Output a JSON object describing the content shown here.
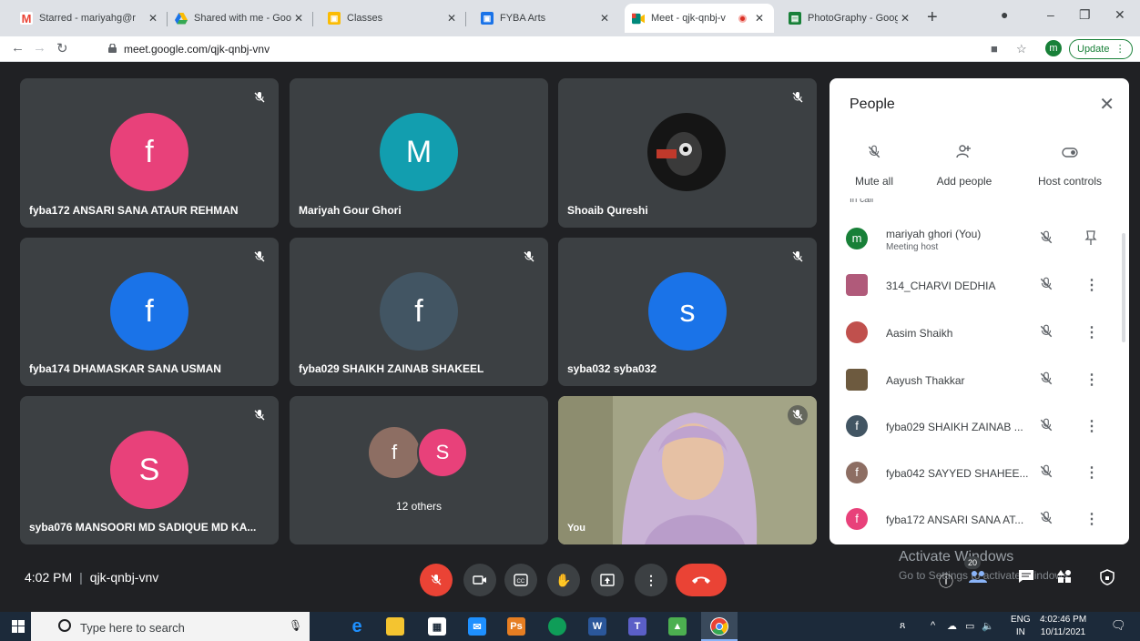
{
  "browser": {
    "tabs": [
      {
        "title": "Starred - mariyahg@r",
        "favicon": "gmail-icon",
        "color": "#ea4335"
      },
      {
        "title": "Shared with me - Goo",
        "favicon": "drive-icon",
        "color": "#1a73e8"
      },
      {
        "title": "Classes",
        "favicon": "classroom-icon",
        "color": "#fbbc04"
      },
      {
        "title": "FYBA Arts",
        "favicon": "classroom-icon",
        "color": "#1a73e8"
      },
      {
        "title": "Meet - qjk-qnbj-v",
        "favicon": "meet-icon",
        "color": "#00897b"
      },
      {
        "title": "PhotoGraphy - Google",
        "favicon": "sheets-icon",
        "color": "#188038"
      }
    ],
    "url": "meet.google.com/qjk-qnbj-vnv",
    "profile_initial": "m",
    "update_label": "Update"
  },
  "tiles": [
    {
      "name": "fyba172 ANSARI SANA ATAUR REHMAN",
      "initial": "f",
      "avatar_color": "#e8417a"
    },
    {
      "name": "Mariyah Gour Ghori",
      "initial": "M",
      "avatar_color": "#129eaf"
    },
    {
      "name": "Shoaib Qureshi",
      "initial": "",
      "avatar_color": "#1f1f1f"
    },
    {
      "name": "fyba174 DHAMASKAR SANA USMAN",
      "initial": "f",
      "avatar_color": "#1a73e8"
    },
    {
      "name": "fyba029 SHAIKH ZAINAB SHAKEEL",
      "initial": "f",
      "avatar_color": "#425563"
    },
    {
      "name": "syba032 syba032",
      "initial": "s",
      "avatar_color": "#1a73e8"
    },
    {
      "name": "syba076 MANSOORI MD SADIQUE MD KA...",
      "initial": "S",
      "avatar_color": "#e8417a"
    },
    {
      "name": "12 others",
      "initial_1": "f",
      "initial_2": "S",
      "color_1": "#8d6e63",
      "color_2": "#e8417a"
    },
    {
      "name": "You"
    }
  ],
  "people": {
    "title": "People",
    "actions": {
      "mute_all": "Mute all",
      "add_people": "Add people",
      "host_controls": "Host controls"
    },
    "section_label": "In call",
    "list": [
      {
        "name": "mariyah ghori (You)",
        "sub": "Meeting host",
        "initial": "m",
        "color": "#188038"
      },
      {
        "name": "314_CHARVI DEDHIA",
        "initial": "",
        "color": "#b05a7a"
      },
      {
        "name": "Aasim Shaikh",
        "initial": "",
        "color": "#c0504d"
      },
      {
        "name": "Aayush Thakkar",
        "initial": "",
        "color": "#6d5a3f"
      },
      {
        "name": "fyba029 SHAIKH ZAINAB ...",
        "initial": "f",
        "color": "#425563"
      },
      {
        "name": "fyba042 SAYYED SHAHEE...",
        "initial": "f",
        "color": "#8d6e63"
      },
      {
        "name": "fyba172 ANSARI SANA AT...",
        "initial": "f",
        "color": "#e8417a"
      }
    ]
  },
  "meeting": {
    "time": "4:02 PM",
    "code": "qjk-qnbj-vnv",
    "participant_count": "20"
  },
  "watermark": {
    "line1": "Activate Windows",
    "line2": "Go to Settings to activate Windows."
  },
  "taskbar": {
    "search_placeholder": "Type here to search",
    "lang_1": "ENG",
    "lang_2": "IN",
    "time": "4:02:46 PM",
    "date": "10/11/2021"
  }
}
